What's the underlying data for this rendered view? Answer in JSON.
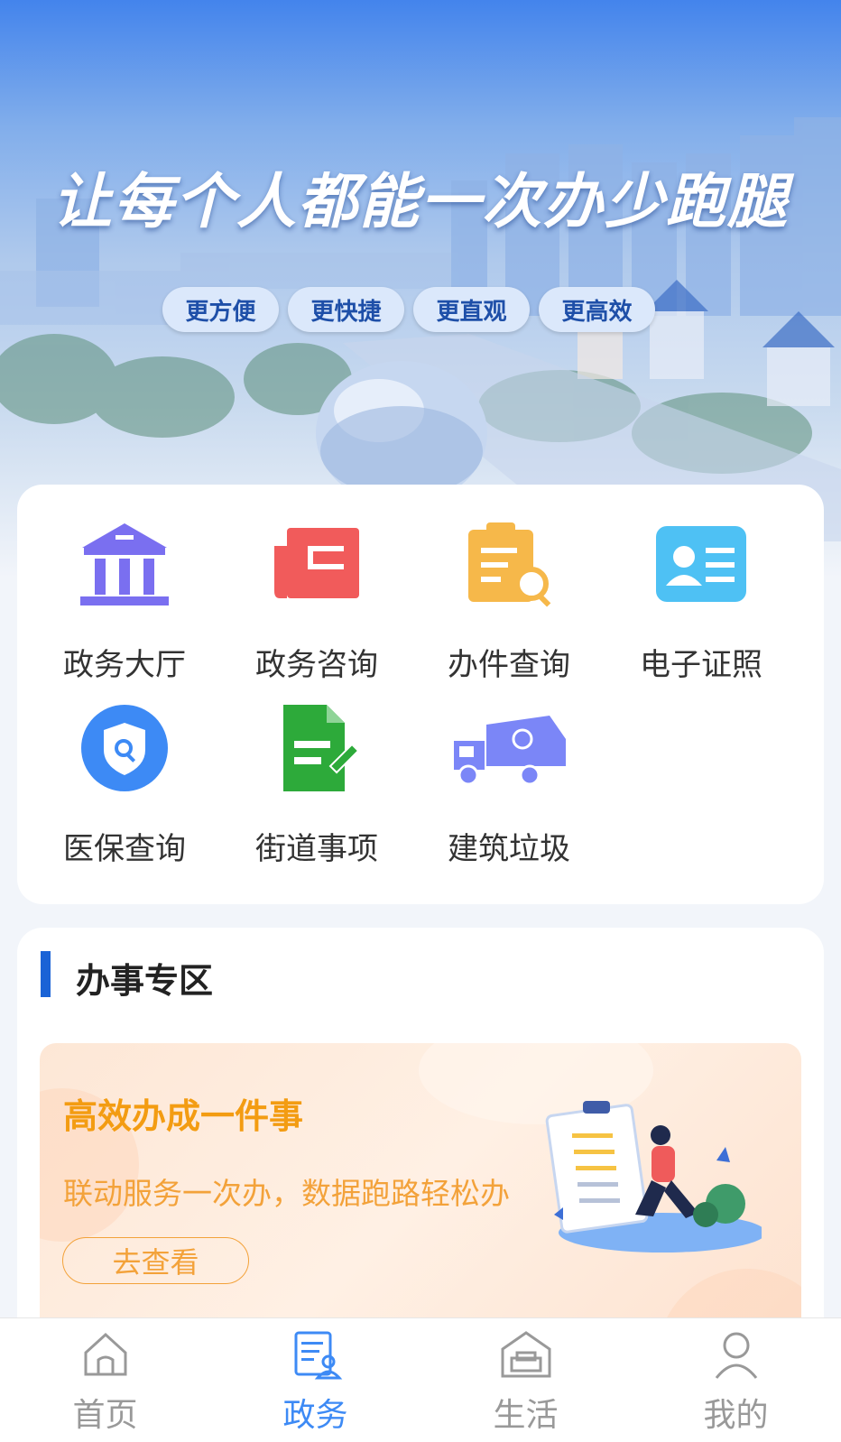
{
  "hero": {
    "slogan": "让每个人都能一次办少跑腿",
    "pills": [
      "更方便",
      "更快捷",
      "更直观",
      "更高效"
    ]
  },
  "services": [
    {
      "label": "政务大厅",
      "icon": "government-hall-icon",
      "color": "#7a6ff0"
    },
    {
      "label": "政务咨询",
      "icon": "consult-document-icon",
      "color": "#f15b5b"
    },
    {
      "label": "办件查询",
      "icon": "clipboard-search-icon",
      "color": "#f6b84a"
    },
    {
      "label": "电子证照",
      "icon": "id-card-icon",
      "color": "#4ec1f4"
    },
    {
      "label": "医保查询",
      "icon": "shield-search-icon",
      "color": "#3d8af5"
    },
    {
      "label": "街道事项",
      "icon": "document-edit-icon",
      "color": "#2daa3a"
    },
    {
      "label": "建筑垃圾",
      "icon": "garbage-truck-icon",
      "color": "#7b86f7"
    }
  ],
  "zone": {
    "title": "办事专区",
    "promo": {
      "title": "高效办成一件事",
      "subtitle": "联动服务一次办，数据跑路轻松办",
      "button": "去查看"
    }
  },
  "tabbar": {
    "active_index": 1,
    "items": [
      {
        "label": "首页",
        "icon": "home-icon"
      },
      {
        "label": "政务",
        "icon": "government-affairs-icon"
      },
      {
        "label": "生活",
        "icon": "life-sofa-icon"
      },
      {
        "label": "我的",
        "icon": "user-icon"
      }
    ]
  },
  "colors": {
    "accent": "#3d8af5",
    "section_bar": "#1a63d6",
    "promo_orange": "#f39c12"
  }
}
